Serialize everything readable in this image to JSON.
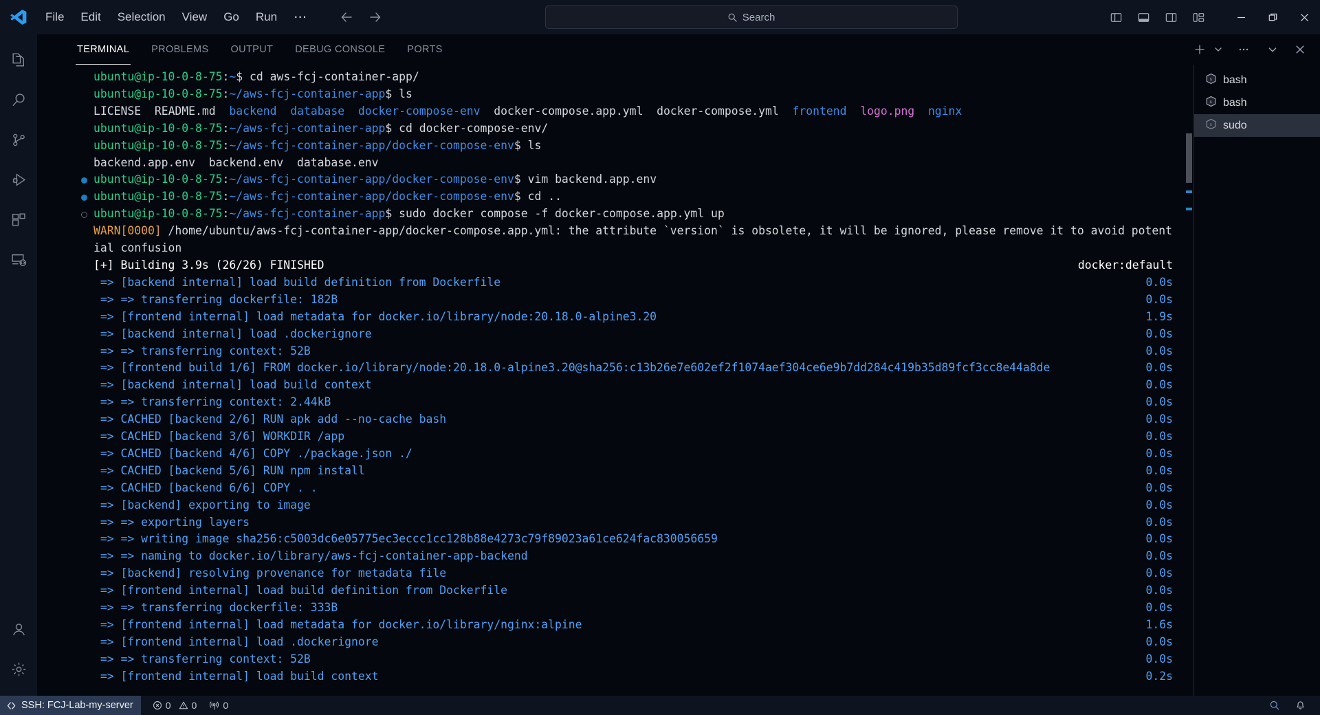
{
  "titlebar": {
    "logo_icon": "vscode-logo-icon",
    "menus": [
      {
        "label": "File"
      },
      {
        "label": "Edit"
      },
      {
        "label": "Selection"
      },
      {
        "label": "View"
      },
      {
        "label": "Go"
      },
      {
        "label": "Run"
      }
    ],
    "more_label": "⋯",
    "nav": {
      "back_icon": "arrow-left-icon",
      "forward_icon": "arrow-right-icon"
    },
    "search": {
      "placeholder": "Search",
      "icon": "search-icon"
    },
    "layout_buttons": [
      {
        "name": "toggle-primary-side-bar",
        "icon": "layout-sidebar-left-icon"
      },
      {
        "name": "toggle-panel",
        "icon": "layout-panel-icon"
      },
      {
        "name": "toggle-secondary-side-bar",
        "icon": "layout-sidebar-right-icon"
      },
      {
        "name": "customize-layout",
        "icon": "layout-customize-icon"
      }
    ],
    "window_controls": [
      {
        "name": "minimize-button",
        "glyph": "—"
      },
      {
        "name": "maximize-button",
        "glyph": "❐"
      },
      {
        "name": "close-button",
        "glyph": "✕"
      }
    ]
  },
  "activitybar": {
    "items": [
      {
        "name": "explorer",
        "icon": "files-icon",
        "active": false
      },
      {
        "name": "search",
        "icon": "search-icon",
        "active": false
      },
      {
        "name": "source-control",
        "icon": "source-control-icon",
        "active": false
      },
      {
        "name": "run-and-debug",
        "icon": "debug-play-icon",
        "active": false
      },
      {
        "name": "extensions",
        "icon": "extensions-icon",
        "active": false
      },
      {
        "name": "remote-explorer",
        "icon": "remote-explorer-icon",
        "active": false
      }
    ],
    "bottom": [
      {
        "name": "accounts",
        "icon": "account-icon"
      },
      {
        "name": "manage",
        "icon": "gear-icon"
      }
    ]
  },
  "panel": {
    "tabs": [
      {
        "label": "TERMINAL",
        "active": true
      },
      {
        "label": "PROBLEMS",
        "active": false
      },
      {
        "label": "OUTPUT",
        "active": false
      },
      {
        "label": "DEBUG CONSOLE",
        "active": false
      },
      {
        "label": "PORTS",
        "active": false
      }
    ],
    "actions": [
      {
        "name": "new-terminal-button",
        "icon": "plus-icon"
      },
      {
        "name": "new-terminal-dropdown",
        "icon": "chevron-down-icon"
      },
      {
        "name": "terminal-views-and-more",
        "icon": "ellipsis-icon"
      },
      {
        "name": "hide-panel-button",
        "icon": "chevron-down-icon"
      },
      {
        "name": "close-panel-button",
        "icon": "close-icon"
      }
    ]
  },
  "terminal_tabs": {
    "items": [
      {
        "label": "bash",
        "icon": "terminal-bash-icon",
        "selected": false
      },
      {
        "label": "bash",
        "icon": "terminal-bash-icon",
        "selected": false
      },
      {
        "label": "sudo",
        "icon": "terminal-bash-icon",
        "selected": true
      }
    ]
  },
  "terminal": {
    "prompt_user": "ubuntu@ip-10-0-8-75",
    "lines": [
      {
        "type": "prompt",
        "deco": null,
        "user": "ubuntu@ip-10-0-8-75",
        "sep": ":",
        "path": "~",
        "tail": "$ ",
        "cmd": "cd aws-fcj-container-app/"
      },
      {
        "type": "prompt",
        "deco": null,
        "user": "ubuntu@ip-10-0-8-75",
        "sep": ":",
        "path": "~/aws-fcj-container-app",
        "tail": "$ ",
        "cmd": "ls"
      },
      {
        "type": "ls",
        "items": [
          {
            "text": "LICENSE",
            "color": "w"
          },
          {
            "text": "README.md",
            "color": "w"
          },
          {
            "text": "backend",
            "color": "b"
          },
          {
            "text": "database",
            "color": "b"
          },
          {
            "text": "docker-compose-env",
            "color": "b"
          },
          {
            "text": "docker-compose.app.yml",
            "color": "w"
          },
          {
            "text": "docker-compose.yml",
            "color": "w"
          },
          {
            "text": "frontend",
            "color": "b"
          },
          {
            "text": "logo.png",
            "color": "m"
          },
          {
            "text": "nginx",
            "color": "b"
          }
        ]
      },
      {
        "type": "prompt",
        "deco": null,
        "user": "ubuntu@ip-10-0-8-75",
        "sep": ":",
        "path": "~/aws-fcj-container-app",
        "tail": "$ ",
        "cmd": "cd docker-compose-env/"
      },
      {
        "type": "prompt",
        "deco": null,
        "user": "ubuntu@ip-10-0-8-75",
        "sep": ":",
        "path": "~/aws-fcj-container-app/docker-compose-env",
        "tail": "$ ",
        "cmd": "ls"
      },
      {
        "type": "plain",
        "color": "w",
        "text": "backend.app.env  backend.env  database.env"
      },
      {
        "type": "prompt",
        "deco": "ok",
        "user": "ubuntu@ip-10-0-8-75",
        "sep": ":",
        "path": "~/aws-fcj-container-app/docker-compose-env",
        "tail": "$ ",
        "cmd": "vim backend.app.env"
      },
      {
        "type": "prompt",
        "deco": "ok",
        "user": "ubuntu@ip-10-0-8-75",
        "sep": ":",
        "path": "~/aws-fcj-container-app/docker-compose-env",
        "tail": "$ ",
        "cmd": "cd .."
      },
      {
        "type": "prompt",
        "deco": "run",
        "user": "ubuntu@ip-10-0-8-75",
        "sep": ":",
        "path": "~/aws-fcj-container-app",
        "tail": "$ ",
        "cmd": "sudo docker compose -f docker-compose.app.yml up"
      },
      {
        "type": "warn",
        "tag": "WARN[0000]",
        "text": " /home/ubuntu/aws-fcj-container-app/docker-compose.app.yml: the attribute `version` is obsolete, it will be ignored, please remove it to avoid potential confusion"
      },
      {
        "type": "build-header",
        "text": "[+] Building 3.9s (26/26) FINISHED",
        "right": "docker:default"
      },
      {
        "type": "step",
        "text": " => [backend internal] load build definition from Dockerfile",
        "right": "0.0s"
      },
      {
        "type": "step",
        "text": " => => transferring dockerfile: 182B",
        "right": "0.0s"
      },
      {
        "type": "step",
        "text": " => [frontend internal] load metadata for docker.io/library/node:20.18.0-alpine3.20",
        "right": "1.9s"
      },
      {
        "type": "step",
        "text": " => [backend internal] load .dockerignore",
        "right": "0.0s"
      },
      {
        "type": "step",
        "text": " => => transferring context: 52B",
        "right": "0.0s"
      },
      {
        "type": "step",
        "text": " => [frontend build 1/6] FROM docker.io/library/node:20.18.0-alpine3.20@sha256:c13b26e7e602ef2f1074aef304ce6e9b7dd284c419b35d89fcf3cc8e44a8de",
        "right": "0.0s"
      },
      {
        "type": "step",
        "text": " => [backend internal] load build context",
        "right": "0.0s"
      },
      {
        "type": "step",
        "text": " => => transferring context: 2.44kB",
        "right": "0.0s"
      },
      {
        "type": "step",
        "text": " => CACHED [backend 2/6] RUN apk add --no-cache bash",
        "right": "0.0s"
      },
      {
        "type": "step",
        "text": " => CACHED [backend 3/6] WORKDIR /app",
        "right": "0.0s"
      },
      {
        "type": "step",
        "text": " => CACHED [backend 4/6] COPY ./package.json ./",
        "right": "0.0s"
      },
      {
        "type": "step",
        "text": " => CACHED [backend 5/6] RUN npm install",
        "right": "0.0s"
      },
      {
        "type": "step",
        "text": " => CACHED [backend 6/6] COPY . .",
        "right": "0.0s"
      },
      {
        "type": "step",
        "text": " => [backend] exporting to image",
        "right": "0.0s"
      },
      {
        "type": "step",
        "text": " => => exporting layers",
        "right": "0.0s"
      },
      {
        "type": "step",
        "text": " => => writing image sha256:c5003dc6e05775ec3eccc1cc128b88e4273c79f89023a61ce624fac830056659",
        "right": "0.0s"
      },
      {
        "type": "step",
        "text": " => => naming to docker.io/library/aws-fcj-container-app-backend",
        "right": "0.0s"
      },
      {
        "type": "step",
        "text": " => [backend] resolving provenance for metadata file",
        "right": "0.0s"
      },
      {
        "type": "step",
        "text": " => [frontend internal] load build definition from Dockerfile",
        "right": "0.0s"
      },
      {
        "type": "step",
        "text": " => => transferring dockerfile: 333B",
        "right": "0.0s"
      },
      {
        "type": "step",
        "text": " => [frontend internal] load metadata for docker.io/library/nginx:alpine",
        "right": "1.6s"
      },
      {
        "type": "step",
        "text": " => [frontend internal] load .dockerignore",
        "right": "0.0s"
      },
      {
        "type": "step",
        "text": " => => transferring context: 52B",
        "right": "0.0s"
      },
      {
        "type": "step",
        "text": " => [frontend internal] load build context",
        "right": "0.2s"
      }
    ]
  },
  "statusbar": {
    "remote": {
      "label": "SSH: FCJ-Lab-my-server",
      "icon": "remote-indicator-icon"
    },
    "problems": {
      "errors_icon": "error-circle-icon",
      "errors": "0",
      "warnings_icon": "warning-triangle-icon",
      "warnings": "0"
    },
    "ports": {
      "icon": "radio-tower-icon",
      "count": "0"
    },
    "right": [
      {
        "name": "editor-zoom",
        "icon": "zoom-icon"
      },
      {
        "name": "notifications",
        "icon": "bell-icon"
      }
    ]
  },
  "colors": {
    "accent": "#0b84ff",
    "green": "#23d18b",
    "blue": "#3b8eea",
    "docker_blue": "#4ea0f5",
    "magenta": "#d670d6",
    "warn_orange": "#e5a03c",
    "bg": "#04070d",
    "chrome": "#0e1320"
  }
}
